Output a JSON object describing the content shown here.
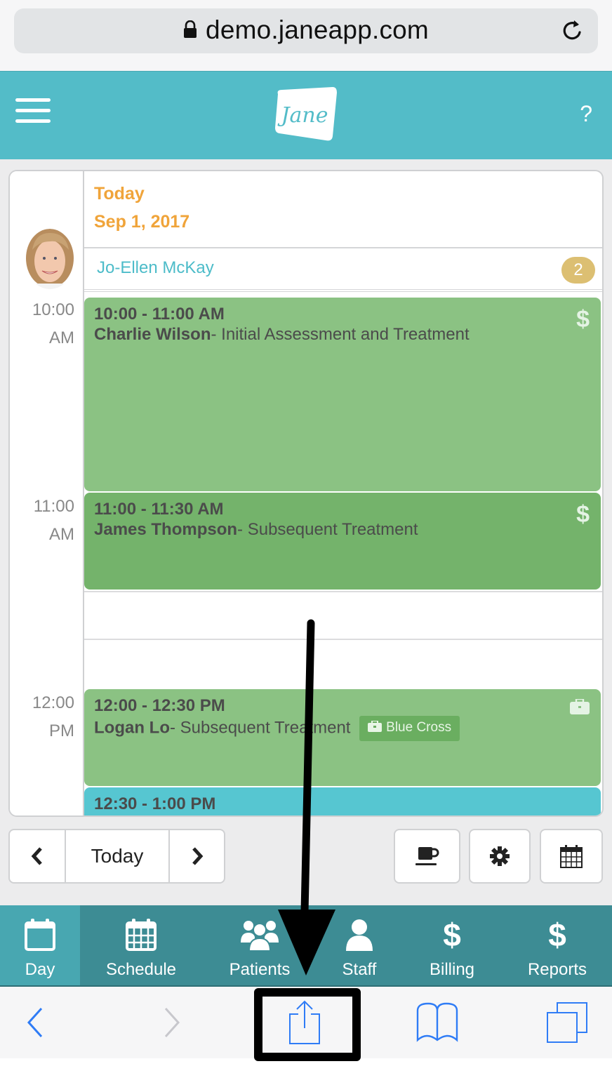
{
  "browser": {
    "url": "demo.janeapp.com",
    "lock_icon": "lock-icon",
    "reload_icon": "reload-icon"
  },
  "header": {
    "menu_icon": "hamburger-menu-icon",
    "logo_text": "Jane",
    "help_label": "?"
  },
  "calendar": {
    "day_label": "Today",
    "date": "Sep 1, 2017",
    "staff": {
      "name": "Jo-Ellen McKay",
      "badge_count": "2"
    },
    "time_labels": [
      {
        "hour": "10:00",
        "period": "AM"
      },
      {
        "hour": "11:00",
        "period": "AM"
      },
      {
        "hour": "12:00",
        "period": "PM"
      }
    ],
    "appointments": [
      {
        "time": "10:00 - 11:00 AM",
        "patient": "Charlie Wilson",
        "treatment": "- Initial Assessment and Treatment",
        "status_icon": "$",
        "color": "#8bc283"
      },
      {
        "time": "11:00 - 11:30 AM",
        "patient": "James Thompson",
        "treatment": "- Subsequent Treatment",
        "status_icon": "$",
        "color": "#74b36b"
      },
      {
        "time": "12:00 - 12:30 PM",
        "patient": "Logan Lo",
        "treatment": "- Subsequent Treatment",
        "insurance": "Blue Cross",
        "status_icon": "briefcase",
        "color": "#8bc283"
      },
      {
        "time": "12:30 - 1:00 PM",
        "color": "#56c6d1"
      }
    ]
  },
  "controls": {
    "prev_label": "previous-day",
    "today_label": "Today",
    "next_label": "next-day",
    "break_button": "coffee-icon",
    "settings_button": "gear-icon",
    "calendar_button": "calendar-icon"
  },
  "tabbar": {
    "items": [
      {
        "label": "Day",
        "active": true
      },
      {
        "label": "Schedule"
      },
      {
        "label": "Patients"
      },
      {
        "label": "Staff"
      },
      {
        "label": "Billing"
      },
      {
        "label": "Reports"
      }
    ]
  },
  "safari_toolbar": {
    "back": "back-icon",
    "forward": "forward-icon",
    "share": "share-icon",
    "bookmarks": "bookmarks-icon",
    "tabs": "tabs-icon"
  },
  "colors": {
    "brand_teal": "#53bcc8",
    "tabbar": "#3d8c94",
    "tab_active": "#48a7b1",
    "date_orange": "#f0a43a",
    "staff_teal": "#4dbcc9",
    "badge_gold": "#dcbf72",
    "ios_blue": "#2f7cf6"
  }
}
